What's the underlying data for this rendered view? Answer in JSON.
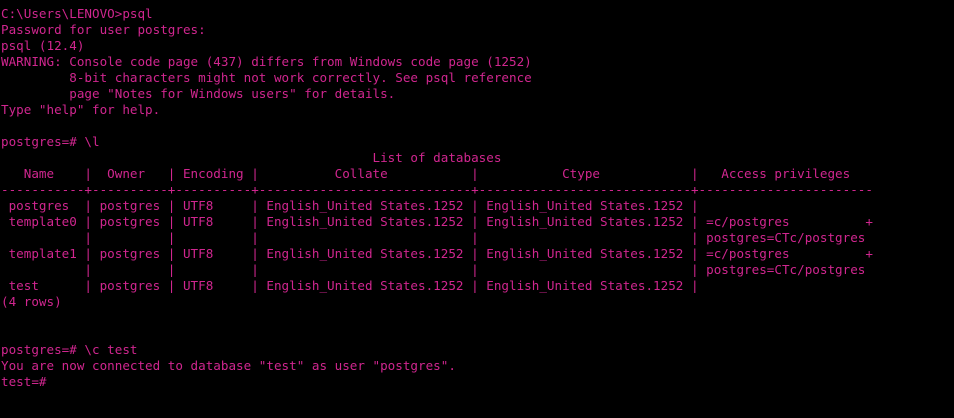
{
  "terminal": {
    "text_color": "#d0268f",
    "background_color": "#000000",
    "lines": [
      "C:\\Users\\LENOVO>psql",
      "Password for user postgres:",
      "psql (12.4)",
      "WARNING: Console code page (437) differs from Windows code page (1252)",
      "         8-bit characters might not work correctly. See psql reference",
      "         page \"Notes for Windows users\" for details.",
      "Type \"help\" for help.",
      "",
      "postgres=# \\l",
      "                                                 List of databases",
      "   Name    |  Owner   | Encoding |          Collate           |           Ctype            |   Access privileges",
      "-----------+----------+----------+----------------------------+----------------------------+-----------------------",
      " postgres  | postgres | UTF8     | English_United States.1252 | English_United States.1252 |",
      " template0 | postgres | UTF8     | English_United States.1252 | English_United States.1252 | =c/postgres          +",
      "           |          |          |                            |                            | postgres=CTc/postgres",
      " template1 | postgres | UTF8     | English_United States.1252 | English_United States.1252 | =c/postgres          +",
      "           |          |          |                            |                            | postgres=CTc/postgres",
      " test      | postgres | UTF8     | English_United States.1252 | English_United States.1252 |",
      "(4 rows)",
      "",
      "",
      "postgres=# \\c test",
      "You are now connected to database \"test\" as user \"postgres\".",
      "test=#"
    ]
  }
}
